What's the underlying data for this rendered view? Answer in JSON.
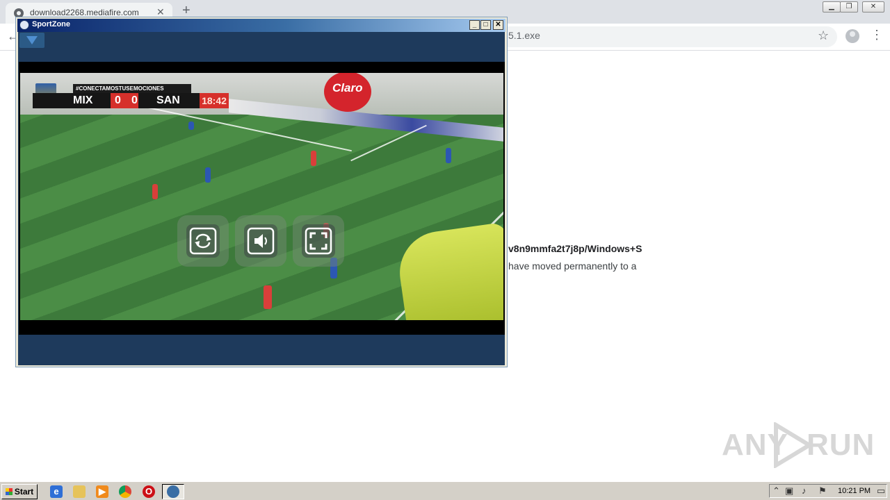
{
  "browser": {
    "tab_title": "download2268.mediafire.com",
    "tab_close_glyph": "✕",
    "new_tab_glyph": "+",
    "address_visible": "5.1.exe",
    "back_glyph": "←",
    "star_glyph": "☆",
    "menu_glyph": "⋮"
  },
  "page": {
    "line1": "v8n9mmfa2t7j8p/Windows+S",
    "line2": "have moved permanently to a"
  },
  "watermark": {
    "left": "ANY",
    "right": "RUN"
  },
  "sportzone": {
    "title": "SportZone",
    "minimize": "_",
    "maximize": "□",
    "close": "✕",
    "scorebug": {
      "hashtag": "#CONECTAMOSTUSEMOCIONES",
      "home_team": "MIX",
      "home_score": "0",
      "away_score": "0",
      "away_team": "SAN",
      "clock": "18:42"
    },
    "balloon_text": "Claro",
    "controls": [
      "replay-icon",
      "volume-icon",
      "fullscreen-icon"
    ]
  },
  "taskbar": {
    "start_label": "Start",
    "clock": "10:21 PM"
  }
}
